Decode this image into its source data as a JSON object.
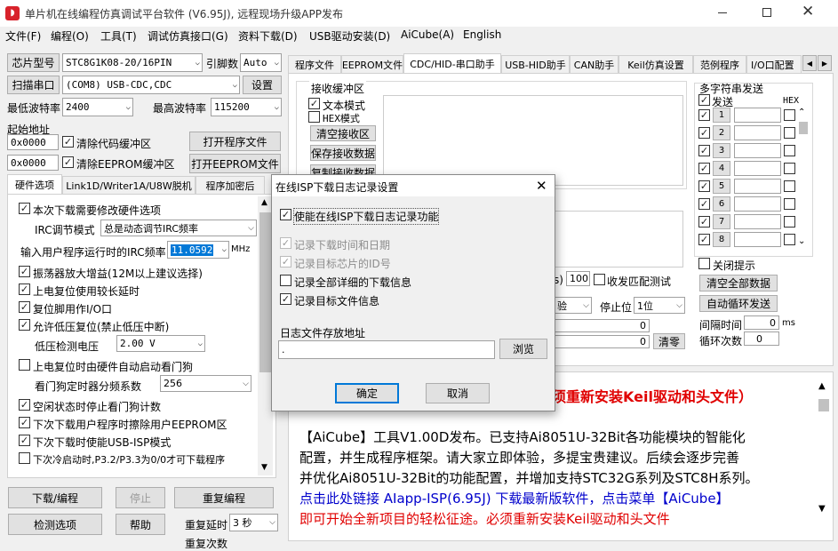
{
  "window": {
    "title": "单片机在线编程仿真调试平台软件 (V6.95J), 远程现场升级APP发布"
  },
  "menu": [
    "文件(F)",
    "编程(O)",
    "工具(T)",
    "调试仿真接口(G)",
    "资料下载(D)",
    "USB驱动安装(D)",
    "AiCube(A)",
    "English"
  ],
  "left": {
    "chip_type_btn": "芯片型号",
    "chip_value": "STC8G1K08-20/16PIN",
    "pins_label": "引脚数",
    "pins_value": "Auto",
    "scan_btn": "扫描串口",
    "port_value": "(COM8) USB-CDC,CDC",
    "settings_btn": "设置",
    "min_baud_label": "最低波特率",
    "min_baud_value": "2400",
    "max_baud_label": "最高波特率",
    "max_baud_value": "115200",
    "start_addr_label": "起始地址",
    "addr1": "0x0000",
    "clear_code": "清除代码缓冲区",
    "open_prog": "打开程序文件",
    "addr2": "0x0000",
    "clear_eeprom": "清除EEPROM缓冲区",
    "open_eeprom": "打开EEPROM文件"
  },
  "hw_tabs": [
    "硬件选项",
    "Link1D/Writer1A/U8W脱机",
    "程序加密后"
  ],
  "hw_options": {
    "opt1": "本次下载需要修改硬件选项",
    "irc_mode_label": "IRC调节模式",
    "irc_mode_value": "总是动态调节IRC频率",
    "irc_freq_label": "输入用户程序运行时的IRC频率",
    "irc_freq_value": "11.0592",
    "irc_freq_unit": "MHz",
    "opt2": "振荡器放大增益(12M以上建议选择)",
    "opt3": "上电复位使用较长延时",
    "opt4": "复位脚用作I/O口",
    "opt5": "允许低压复位(禁止低压中断)",
    "lvd_label": "低压检测电压",
    "lvd_value": "2.00 V",
    "opt6": "上电复位时由硬件自动启动看门狗",
    "wdt_label": "看门狗定时器分频系数",
    "wdt_value": "256",
    "opt7": "空闲状态时停止看门狗计数",
    "opt8": "下次下载用户程序时擦除用户EEPROM区",
    "opt9": "下次下载时使能USB-ISP模式",
    "opt10": "下次冷启动时,P3.2/P3.3为0/0才可下载程序"
  },
  "bottom_btns": {
    "download": "下载/编程",
    "stop": "停止",
    "reprogram": "重复编程",
    "check": "检测选项",
    "help": "帮助",
    "repeat_delay_label": "重复延时",
    "repeat_delay_value": "3 秒",
    "repeat_count_label": "重复次数"
  },
  "right_tabs": [
    "程序文件",
    "EEPROM文件",
    "CDC/HID-串口助手",
    "USB-HID助手",
    "CAN助手",
    "Keil仿真设置",
    "范例程序",
    "I/O口配置"
  ],
  "serial": {
    "recv_title": "接收缓冲区",
    "text_mode": "文本模式",
    "hex_mode": "HEX模式",
    "clear_recv": "清空接收区",
    "save_recv": "保存接收数据",
    "copy_recv": "复制接收数据",
    "timeout_tail": "s)",
    "timeout_value": "100",
    "match_label": "收发匹配测试",
    "verify_tail": "验",
    "stopbit_label": "停止位",
    "stopbit_value": "1位",
    "count1": "0",
    "count2": "0",
    "clear_count": "清零"
  },
  "multi": {
    "title": "多字符串发送",
    "send_col": "发送",
    "hex_col": "HEX",
    "rows": [
      "1",
      "2",
      "3",
      "4",
      "5",
      "6",
      "7",
      "8"
    ],
    "close_tip": "关闭提示",
    "clear_all": "清空全部数据",
    "auto_loop": "自动循环发送",
    "interval_label": "间隔时间",
    "interval_value": "0",
    "interval_unit": "ms",
    "loop_label": "循环次数",
    "loop_value": "0"
  },
  "news": {
    "line0": "须重新安装Keil驱动和头文件）",
    "line1": "【AiCube】工具V1.00D发布。已支持Ai8051U-32Bit各功能模块的智能化",
    "line2": "配置，并生成程序框架。请大家立即体验，多提宝贵建议。后续会逐步完善",
    "line3": "并优化Ai8051U-32Bit的功能配置，并增加支持STC32G系列及STC8H系列。",
    "line4": "点击此处链接  AIapp-ISP(6.95J)  下载最新版软件，点击菜单【AiCube】",
    "line5": "即可开始全新项目的轻松征途。必须重新安装Keil驱动和头文件"
  },
  "dialog": {
    "title": "在线ISP下载日志记录设置",
    "enable": "使能在线ISP下载日志记录功能",
    "rec_time": "记录下载时间和日期",
    "rec_id": "记录目标芯片的ID号",
    "rec_detail": "记录全部详细的下载信息",
    "rec_file": "记录目标文件信息",
    "path_label": "日志文件存放地址",
    "path_value": ".",
    "browse": "浏览",
    "ok": "确定",
    "cancel": "取消"
  },
  "colors": {
    "red": "#e00000",
    "blue": "#0000cc",
    "accent": "#0078d7"
  }
}
